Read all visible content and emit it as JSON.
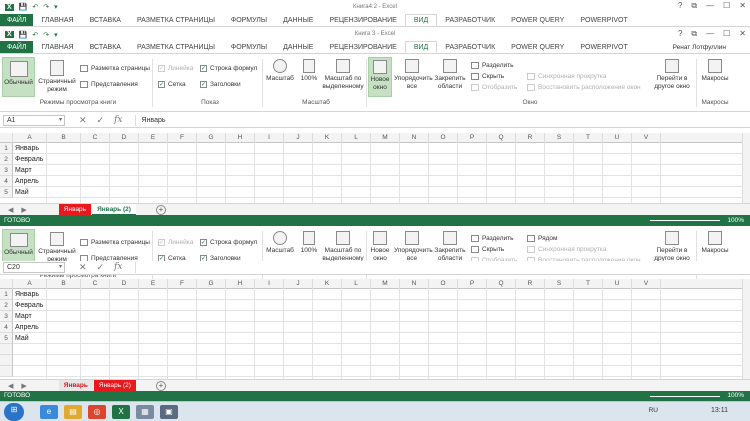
{
  "window_top": {
    "title": "Книга4:2 - Excel",
    "qat": [
      "💾",
      "↶",
      "↷",
      "▾"
    ],
    "winbtns": [
      "?",
      "⧉",
      "—",
      "☐",
      "✕"
    ]
  },
  "window_bottom": {
    "title": "Книга 3 - Excel",
    "qat": [
      "💾",
      "↶",
      "↷",
      "▾"
    ],
    "winbtns": [
      "?",
      "⧉",
      "—",
      "☐",
      "✕"
    ]
  },
  "tabs": [
    "ФАЙЛ",
    "ГЛАВНАЯ",
    "ВСТАВКА",
    "РАЗМЕТКА СТРАНИЦЫ",
    "ФОРМУЛЫ",
    "ДАННЫЕ",
    "РЕЦЕНЗИРОВАНИЕ",
    "ВИД",
    "РАЗРАБОТЧИК",
    "POWER QUERY",
    "POWERPIVOT"
  ],
  "user": "Ренат Лотфуллин",
  "ribbon": {
    "normal": "Обычный",
    "page_mode": "Страничный режим",
    "page_layout": "Разметка страницы",
    "views": "Представления",
    "group_views": "Режимы просмотра книги",
    "ruler": "Линейка",
    "formula_bar": "Строка формул",
    "grid": "Сетка",
    "headings": "Заголовки",
    "group_show": "Показ",
    "zoom": "Масштаб",
    "zoom100": "100%",
    "zoom_sel": "Масштаб по выделенному",
    "group_zoom": "Масштаб",
    "new_window": "Новое окно",
    "arrange": "Упорядочить все",
    "freeze": "Закрепить области",
    "split": "Разделить",
    "hide": "Скрыть",
    "unhide": "Отобразить",
    "side_by_side": "Рядом",
    "sync_scroll": "Синхронная прокрутка",
    "reset_pos": "Восстановить расположение окон",
    "switch": "Перейти в другое окно",
    "group_window": "Окно",
    "macros": "Макросы",
    "group_macros": "Макросы"
  },
  "formula_top": {
    "cell": "A1",
    "value": "Январь"
  },
  "formula_bottom": {
    "cell": "C20",
    "value": ""
  },
  "columns": [
    "A",
    "B",
    "C",
    "D",
    "E",
    "F",
    "G",
    "H",
    "I",
    "J",
    "K",
    "L",
    "M",
    "N",
    "O",
    "P",
    "Q",
    "R",
    "S",
    "T",
    "U",
    "V"
  ],
  "rows": [
    "1",
    "2",
    "3",
    "4",
    "5"
  ],
  "cells": [
    "Январь",
    "Февраль",
    "Март",
    "Апрель",
    "Май"
  ],
  "sheets_top": [
    "Январь",
    "Январь (2)"
  ],
  "sheets_bottom": [
    "Январь",
    "Январь (2)"
  ],
  "status": {
    "ready": "ГОТОВО",
    "zoom": "100%"
  },
  "taskbar": {
    "lang": "RU",
    "time": "13:11"
  },
  "colors": {
    "excel_green": "#217346",
    "sheet_red": "#e8181d"
  }
}
